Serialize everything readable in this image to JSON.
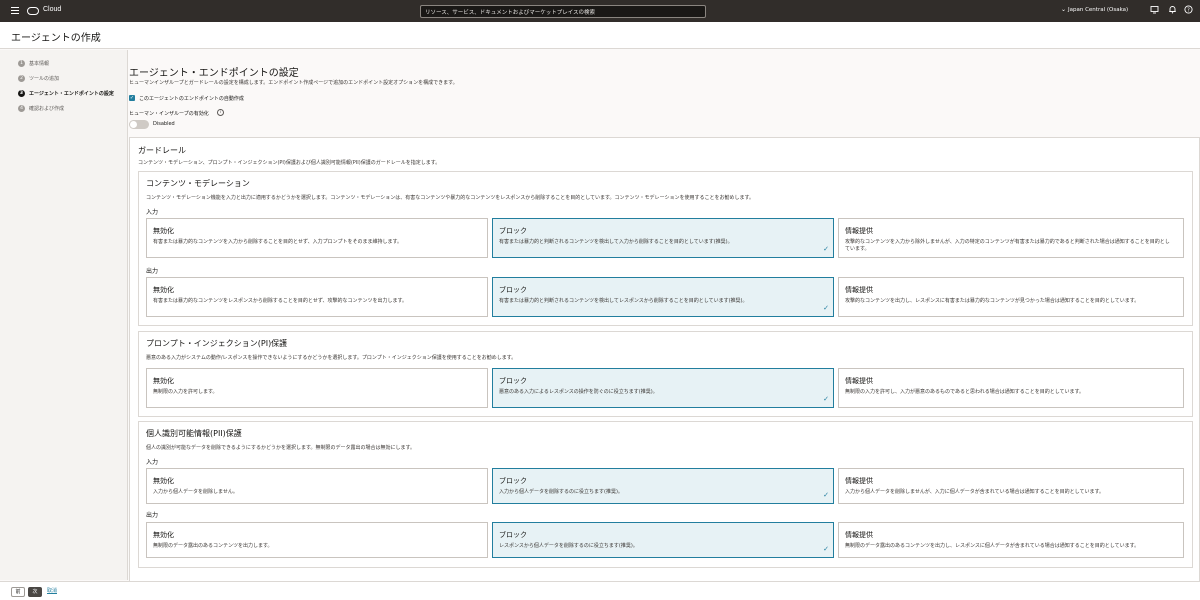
{
  "topbar": {
    "brand": "Cloud",
    "search_placeholder": "リソース、サービス、ドキュメントおよびマーケットプレイスの検索",
    "region": "Japan Central (Osaka)",
    "icons": [
      "menu-icon",
      "oracle-logo-icon",
      "chevron-down-icon",
      "monitor-icon",
      "bell-icon",
      "help-icon",
      "user-icon"
    ]
  },
  "page": {
    "title": "エージェントの作成"
  },
  "steps": [
    {
      "num": "1",
      "label": "基本情報",
      "active": false
    },
    {
      "num": "2",
      "label": "ツールの追加",
      "active": false
    },
    {
      "num": "3",
      "label": "エージェント・エンドポイントの設定",
      "active": true
    },
    {
      "num": "4",
      "label": "確認および作成",
      "active": false
    }
  ],
  "main": {
    "title": "エージェント・エンドポイントの設定",
    "desc": "ヒューマンインザループとガードレールの設定を構成します。エンドポイント作成ページで追加のエンドポイント設定オプションを構成できます。",
    "auto_create_label": "このエージェントのエンドポイントの自動作成",
    "hitl_label": "ヒューマン・インザループの有効化",
    "toggle_label": "Disabled"
  },
  "guardrails": {
    "title": "ガードレール",
    "desc": "コンテンツ・モデレーション、プロンプト・インジェクション(PI)保護および個人識別可能情報(PII)保護のガードレールを指定します。",
    "content_moderation": {
      "title": "コンテンツ・モデレーション",
      "desc": "コンテンツ・モデレーション機能を入力と出力に適用するかどうかを選択します。コンテンツ・モデレーションは、有害なコンテンツや暴力的なコンテンツをレスポンスから削除することを目的としています。コンテンツ・モデレーションを使用することをお勧めします。",
      "input_label": "入力",
      "output_label": "出力",
      "input_options": [
        {
          "title": "無効化",
          "desc": "有害または暴力的なコンテンツを入力から削除することを目的とせず、入力プロンプトをそのまま維持します。"
        },
        {
          "title": "ブロック",
          "desc": "有害または暴力的と判断されるコンテンツを検出して入力から削除することを目的としています(推奨)。"
        },
        {
          "title": "情報提供",
          "desc": "攻撃的なコンテンツを入力から除外しませんが、入力の特定のコンテンツが有害または暴力的であると判断された場合は通知することを目的としています。"
        }
      ],
      "output_options": [
        {
          "title": "無効化",
          "desc": "有害または暴力的なコンテンツをレスポンスから削除することを目的とせず、攻撃的なコンテンツを出力します。"
        },
        {
          "title": "ブロック",
          "desc": "有害または暴力的と判断されるコンテンツを検出してレスポンスから削除することを目的としています(推奨)。"
        },
        {
          "title": "情報提供",
          "desc": "攻撃的なコンテンツを出力し、レスポンスに有害または暴力的なコンテンツが見つかった場合は通知することを目的としています。"
        }
      ]
    },
    "prompt_injection": {
      "title": "プロンプト・インジェクション(PI)保護",
      "desc": "悪意のある入力がシステムの動作/レスポンスを操作できないようにするかどうかを選択します。プロンプト・インジェクション保護を使用することをお勧めします。",
      "options": [
        {
          "title": "無効化",
          "desc": "無制限の入力を許可します。"
        },
        {
          "title": "ブロック",
          "desc": "悪意のある入力によるレスポンスの操作を防ぐのに役立ちます(推奨)。"
        },
        {
          "title": "情報提供",
          "desc": "無制限の入力を許可し、入力が悪意のあるものであると思われる場合は通知することを目的としています。"
        }
      ]
    },
    "pii": {
      "title": "個人識別可能情報(PII)保護",
      "desc": "個人の識別が可能なデータを削除できるようにするかどうかを選択します。無制限のデータ露出の場合は無効にします。",
      "input_label": "入力",
      "output_label": "出力",
      "input_options": [
        {
          "title": "無効化",
          "desc": "入力から個人データを削除しません。"
        },
        {
          "title": "ブロック",
          "desc": "入力から個人データを削除するのに役立ちます(推奨)。"
        },
        {
          "title": "情報提供",
          "desc": "入力から個人データを削除しませんが、入力に個人データが含まれている場合は通知することを目的としています。"
        }
      ],
      "output_options": [
        {
          "title": "無効化",
          "desc": "無制限のデータ露出のあるコンテンツを出力します。"
        },
        {
          "title": "ブロック",
          "desc": "レスポンスから個人データを削除するのに役立ちます(推奨)。"
        },
        {
          "title": "情報提供",
          "desc": "無制限のデータ露出のあるコンテンツを出力し、レスポンスに個人データが含まれている場合は通知することを目的としています。"
        }
      ]
    }
  },
  "footer": {
    "prev": "前",
    "next": "次",
    "cancel": "取消"
  },
  "colors": {
    "accent": "#227e9e",
    "topbar": "#312d2a",
    "selected_bg": "#e7f2f5"
  }
}
